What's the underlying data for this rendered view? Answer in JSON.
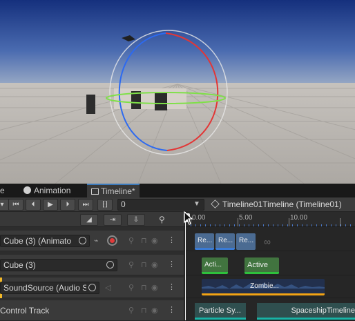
{
  "tabs": [
    {
      "label": "e"
    },
    {
      "label": "Animation"
    },
    {
      "label": "Timeline*"
    }
  ],
  "toolbar": {
    "frame_value": "0",
    "asset_label": "Timeline01Timeline (Timeline01)"
  },
  "ruler": {
    "labels": [
      "0.00",
      "5.00",
      "10.00"
    ]
  },
  "tracks": [
    {
      "name": "Cube (3) (Animato",
      "clips": [
        "Re...",
        "Re...",
        "Re..."
      ]
    },
    {
      "name": "Cube (3)",
      "clips": [
        "Acti...",
        "Active"
      ]
    },
    {
      "name": "SoundSource (Audio S",
      "clips": [
        "Zombie..."
      ]
    },
    {
      "name": "Control Track",
      "clips": [
        "Particle Sy...",
        "SpaceshipTimeline"
      ]
    }
  ],
  "colors": {
    "anim_clip": "#4b6b92",
    "activation_clip": "#41743f",
    "audio_clip": "#22304d",
    "control_clip": "#2f4f4f",
    "tab_accent": "#3a79bb"
  },
  "icons": [
    "first-frame-icon",
    "prev-frame-icon",
    "play-icon",
    "next-frame-icon",
    "last-frame-icon",
    "range-icon",
    "cube-icon"
  ]
}
